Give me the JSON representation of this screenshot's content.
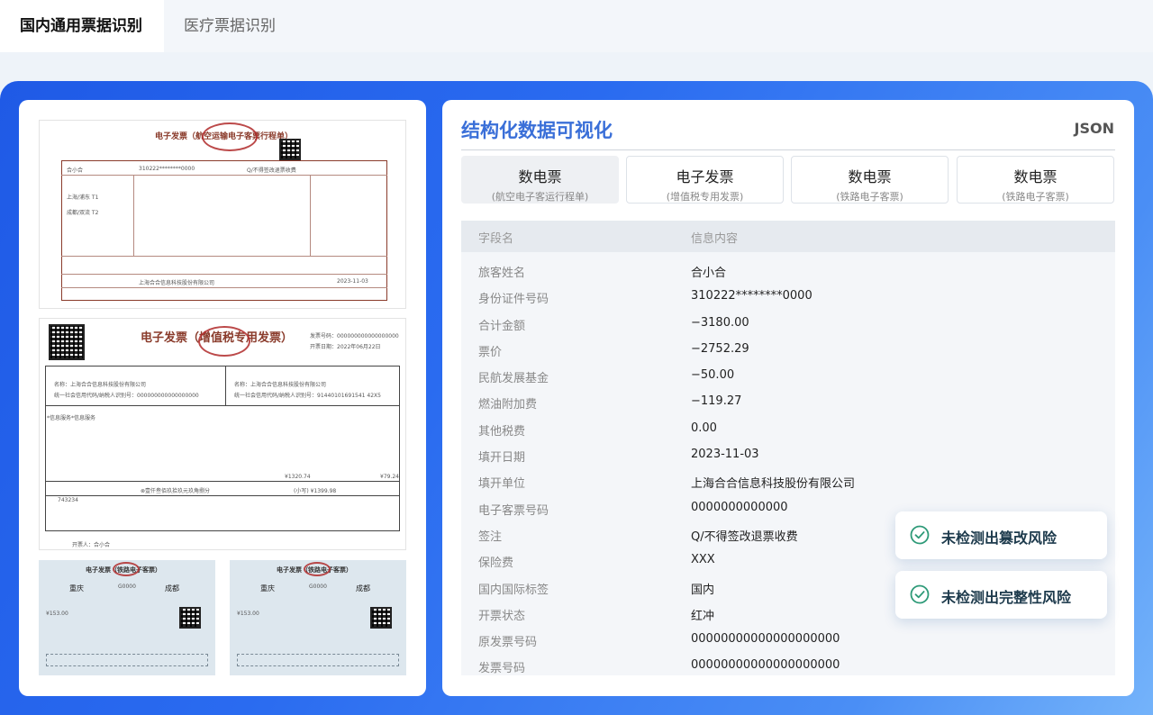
{
  "tabs": [
    "国内通用票据识别",
    "医疗票据识别"
  ],
  "panel": {
    "title": "结构化数据可视化",
    "json_label": "JSON"
  },
  "doc_tabs": [
    {
      "title": "数电票",
      "subtitle": "(航空电子客运行程单)"
    },
    {
      "title": "电子发票",
      "subtitle": "(增值税专用发票)"
    },
    {
      "title": "数电票",
      "subtitle": "(铁路电子客票)"
    },
    {
      "title": "数电票",
      "subtitle": "(铁路电子客票)"
    }
  ],
  "table": {
    "headers": [
      "字段名",
      "信息内容"
    ],
    "rows": [
      {
        "k": "旅客姓名",
        "v": "合小合"
      },
      {
        "k": "身份证件号码",
        "v": "310222********0000"
      },
      {
        "k": "合计金额",
        "v": "−3180.00"
      },
      {
        "k": "票价",
        "v": "−2752.29"
      },
      {
        "k": "民航发展基金",
        "v": "−50.00"
      },
      {
        "k": "燃油附加费",
        "v": "−119.27"
      },
      {
        "k": "其他税费",
        "v": "0.00"
      },
      {
        "k": "填开日期",
        "v": "2023-11-03"
      },
      {
        "k": "填开单位",
        "v": "上海合合信息科技股份有限公司"
      },
      {
        "k": "电子客票号码",
        "v": "0000000000000"
      },
      {
        "k": "签注",
        "v": "Q/不得签改退票收费"
      },
      {
        "k": "保险费",
        "v": "XXX"
      },
      {
        "k": "国内国际标签",
        "v": "国内"
      },
      {
        "k": "开票状态",
        "v": "红冲"
      },
      {
        "k": "原发票号码",
        "v": "00000000000000000000"
      },
      {
        "k": "发票号码",
        "v": "00000000000000000000"
      }
    ]
  },
  "toasts": [
    "未检测出篡改风险",
    "未检测出完整性风险"
  ],
  "invoices": {
    "air": {
      "title": "电子发票（航空运输电子客票行程单）",
      "passenger": "合小合",
      "id": "310222********0000",
      "endorse": "Q/不得签改退票收费",
      "route1": "上海/浦东 T1",
      "route2": "成都/双流 T2",
      "issuer": "上海合合信息科技股份有限公司",
      "date": "2023-11-03"
    },
    "vat": {
      "title": "电子发票（增值税专用发票）",
      "invoice_no": "发票号码：000000000000000000",
      "date": "开票日期：2022年06月22日",
      "seller": "名称：上海合合信息科技股份有限公司",
      "buyer": "名称：上海合合信息科技股份有限公司",
      "tax_id_1": "统一社会信用代码/纳税人识别号：000000000000000000",
      "tax_id_2": "统一社会信用代码/纳税人识别号：91440101691541 42X5",
      "item": "*信息服务*信息服务",
      "amount": "¥1320.74",
      "tax": "¥79.24",
      "total_words": "⊗壹仟叁佰玖拾玖元玖角捌分",
      "total": "(小写) ¥1399.98",
      "remark": "743234",
      "drawer": "开票人：合小合"
    },
    "rail": {
      "title": "电子发票（铁路电子客票）",
      "from": "重庆",
      "to": "成都",
      "train": "G0000",
      "price": "¥153.00"
    }
  }
}
